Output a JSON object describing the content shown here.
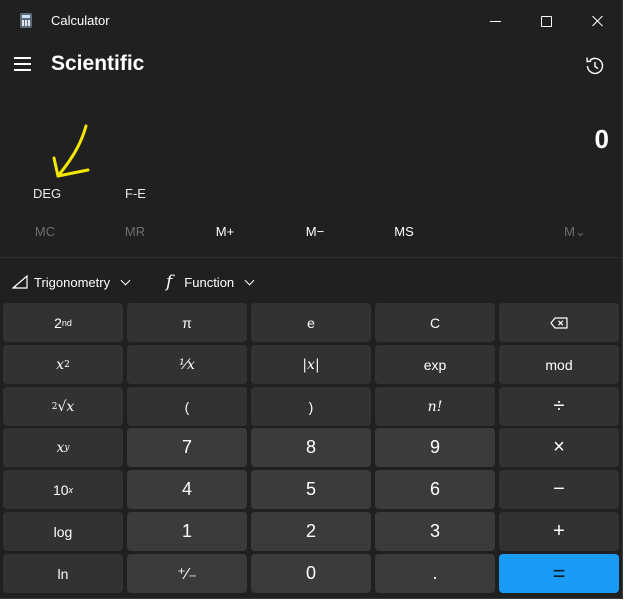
{
  "window": {
    "title": "Calculator"
  },
  "header": {
    "mode_title": "Scientific",
    "history_icon": "history-icon",
    "menu_icon": "hamburger-icon"
  },
  "display": {
    "value": "0"
  },
  "annotation": {
    "color": "#f5e800"
  },
  "toggles": {
    "angle_mode": "DEG",
    "notation": "F-E"
  },
  "memory": {
    "mc": "MC",
    "mr": "MR",
    "m_plus": "M+",
    "m_minus": "M−",
    "ms": "MS",
    "m_list": "M⌄"
  },
  "dropdowns": {
    "trigonometry": "Trigonometry",
    "function": "Function"
  },
  "keys": {
    "second": "2",
    "second_sup": "nd",
    "pi": "π",
    "e": "e",
    "clear": "C",
    "x_sq": "x",
    "x_sq_sup": "2",
    "reciprocal": "¹⁄x",
    "abs": "|x|",
    "exp": "exp",
    "mod": "mod",
    "root_idx": "2",
    "root_x": "√x",
    "lparen": "(",
    "rparen": ")",
    "factorial": "n!",
    "divide": "÷",
    "x_pow": "x",
    "x_pow_sup": "y",
    "seven": "7",
    "eight": "8",
    "nine": "9",
    "multiply": "×",
    "ten_pow": "10",
    "ten_pow_sup": "x",
    "four": "4",
    "five": "5",
    "six": "6",
    "minus": "−",
    "log": "log",
    "one": "1",
    "two": "2",
    "three": "3",
    "plus": "+",
    "ln": "ln",
    "negate": "⁺⁄₋",
    "zero": "0",
    "decimal": ".",
    "equals": "="
  },
  "colors": {
    "background": "#202020",
    "number_key": "#3b3b3b",
    "function_key": "#323232",
    "accent": "#1a9bf5"
  }
}
